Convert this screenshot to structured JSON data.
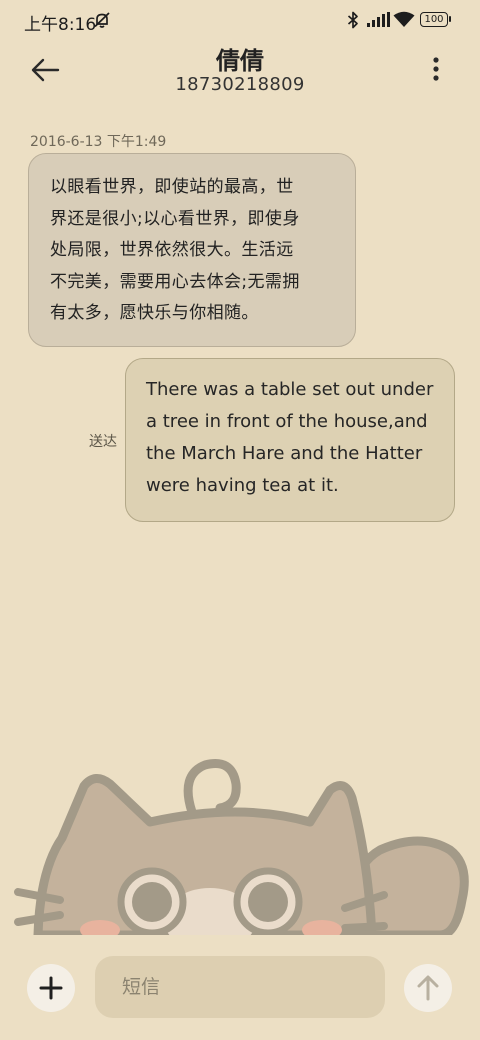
{
  "status_bar": {
    "time": "上午8:16",
    "battery": "100"
  },
  "header": {
    "contact_name": "倩倩",
    "contact_number": "18730218809"
  },
  "messages": [
    {
      "timestamp": "2016-6-13 下午1:49",
      "direction": "incoming",
      "lines": [
        "以眼看世界，即使站的最高，世",
        "界还是很小;以心看世界，即使身",
        "处局限，世界依然很大。生活远",
        "不完美，需要用心去体会;无需拥",
        "有太多，愿快乐与你相随。"
      ]
    },
    {
      "direction": "outgoing",
      "status": "送达",
      "lines": [
        "There was a table set out under",
        "a tree in front of the house,and",
        "the March Hare and the Hatter",
        "were having tea at it."
      ]
    }
  ],
  "composer": {
    "placeholder": "短信"
  },
  "colors": {
    "background": "#ecdfc4",
    "incoming_bubble": "#d8cdb8",
    "outgoing_bubble": "#ddd1b3",
    "input_bg": "#ddcfb1"
  },
  "icons": {
    "back": "arrow-left-icon",
    "more": "vertical-dots-icon",
    "add": "plus-icon",
    "send": "arrow-up-icon",
    "mute": "bell-slash-icon",
    "bluetooth": "bluetooth-icon",
    "signal": "signal-icon",
    "wifi": "wifi-icon"
  }
}
